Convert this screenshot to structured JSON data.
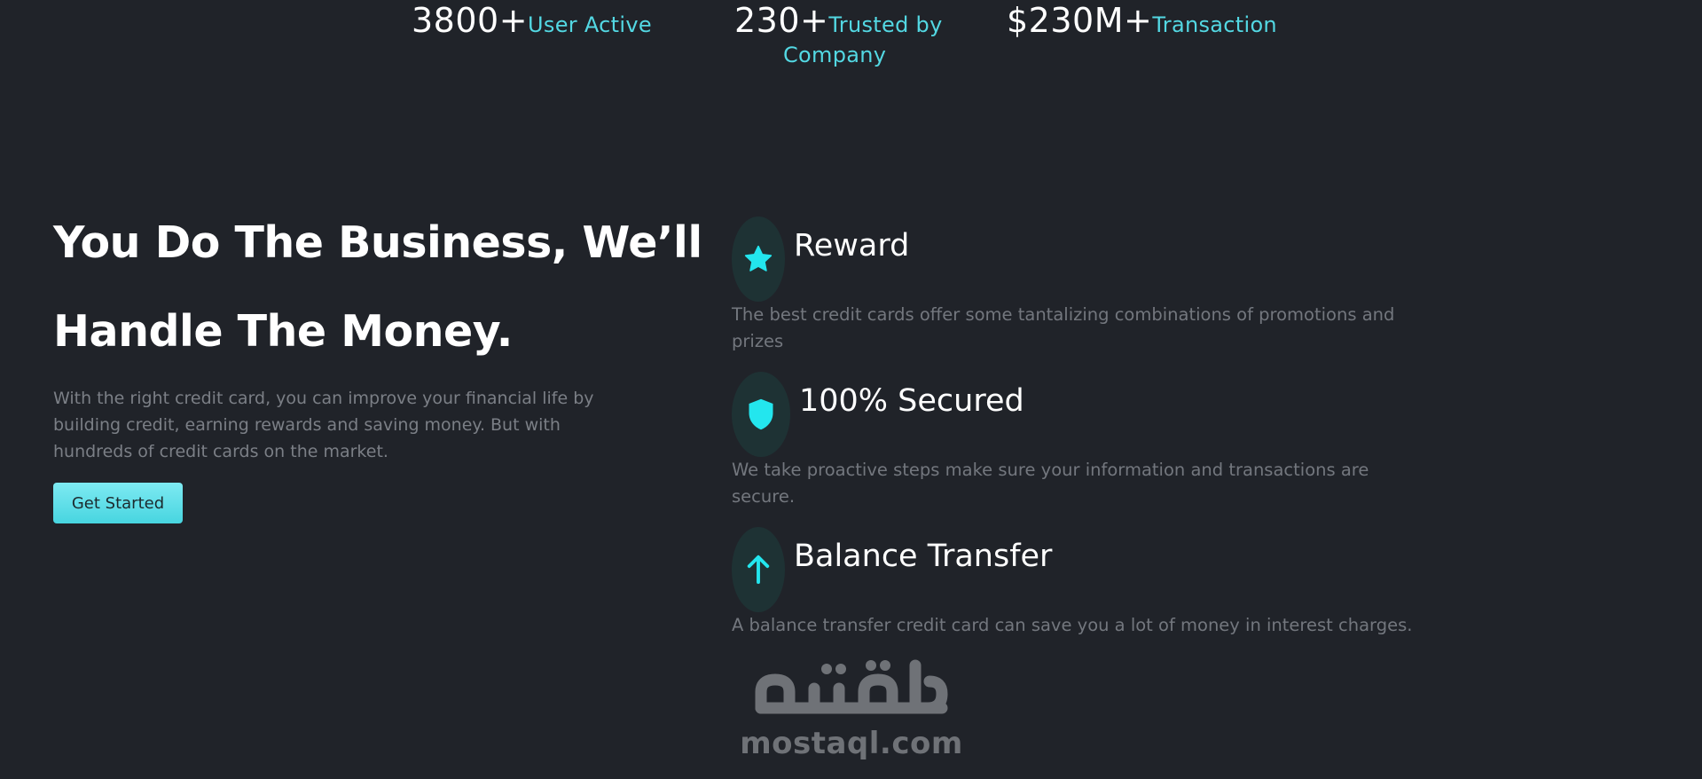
{
  "stats": {
    "users": {
      "number": "3800+",
      "label": "User Active"
    },
    "company": {
      "number": "230+",
      "label_line1": "Trusted by",
      "label_line2": "Company"
    },
    "transactions": {
      "number": "$230M+",
      "label": "Transaction"
    }
  },
  "hero": {
    "heading_line1": "You Do The Business, We’ll",
    "heading_line2": "Handle The Money.",
    "description": "With the right credit card, you can improve your financial life by building credit, earning rewards and saving money. But with hundreds of credit cards on the market.",
    "cta_label": "Get Started"
  },
  "features": [
    {
      "icon": "star-icon",
      "title": "Reward",
      "description": "The best credit cards offer some tantalizing combinations of promotions and prizes"
    },
    {
      "icon": "shield-icon",
      "title": "100% Secured",
      "description": "We take proactive steps make sure your information and transactions are secure."
    },
    {
      "icon": "arrow-up-icon",
      "title": "Balance Transfer",
      "description": "A balance transfer credit card can save you a lot of money in interest charges."
    }
  ],
  "watermark": {
    "text": "mostaql.com",
    "arabic": "مستقل"
  },
  "colors": {
    "background": "#202329",
    "accent": "#53d8e3",
    "icon_circle": "#1e3234",
    "muted_text": "#7b7f86",
    "button_gradient_top": "#7eeaf2",
    "button_gradient_bottom": "#47d5e0"
  }
}
